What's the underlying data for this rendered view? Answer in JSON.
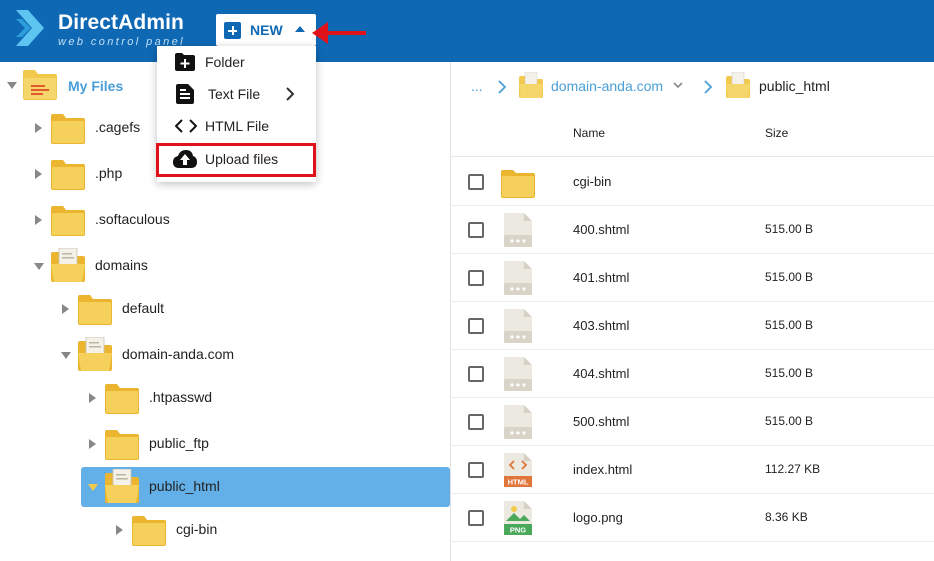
{
  "brand": {
    "name": "DirectAdmin",
    "subtitle": "web control panel",
    "header_color": "#0f68b4"
  },
  "toolbar": {
    "new_label": "NEW",
    "new_icon": "plus-icon",
    "caret_icon": "caret-up-icon"
  },
  "new_menu": {
    "items": [
      {
        "label": "Folder",
        "icon": "folder-plus-icon"
      },
      {
        "label": "Text File",
        "icon": "document-icon",
        "has_submenu": true
      },
      {
        "label": "HTML File",
        "icon": "code-icon"
      },
      {
        "label": "Upload files",
        "icon": "cloud-upload-icon",
        "highlighted": true
      }
    ],
    "highlight_color": "#e0121a"
  },
  "tree": {
    "root_label": "My Files",
    "items": [
      {
        "label": ".cagefs",
        "expanded": false
      },
      {
        "label": ".php",
        "expanded": false
      },
      {
        "label": ".softaculous",
        "expanded": false
      },
      {
        "label": "domains",
        "expanded": true
      },
      {
        "label": "default",
        "expanded": false
      },
      {
        "label": "domain-anda.com",
        "expanded": true
      },
      {
        "label": ".htpasswd",
        "expanded": false
      },
      {
        "label": "public_ftp",
        "expanded": false
      },
      {
        "label": "public_html",
        "expanded": true,
        "selected": true
      },
      {
        "label": "cgi-bin",
        "expanded": false
      }
    ],
    "selected_color": "#63b0e8"
  },
  "breadcrumb": {
    "ellipsis": "...",
    "parent": "domain-anda.com",
    "current": "public_html"
  },
  "table": {
    "col_name": "Name",
    "col_size": "Size",
    "rows": [
      {
        "name": "cgi-bin",
        "size": "",
        "icon": "folder-icon"
      },
      {
        "name": "400.shtml",
        "size": "515.00 B",
        "icon": "file-icon"
      },
      {
        "name": "401.shtml",
        "size": "515.00 B",
        "icon": "file-icon"
      },
      {
        "name": "403.shtml",
        "size": "515.00 B",
        "icon": "file-icon"
      },
      {
        "name": "404.shtml",
        "size": "515.00 B",
        "icon": "file-icon"
      },
      {
        "name": "500.shtml",
        "size": "515.00 B",
        "icon": "file-icon"
      },
      {
        "name": "index.html",
        "size": "112.27 KB",
        "icon": "html-file-icon",
        "badge": "HTML"
      },
      {
        "name": "logo.png",
        "size": "8.36 KB",
        "icon": "png-file-icon",
        "badge": "PNG"
      }
    ]
  }
}
